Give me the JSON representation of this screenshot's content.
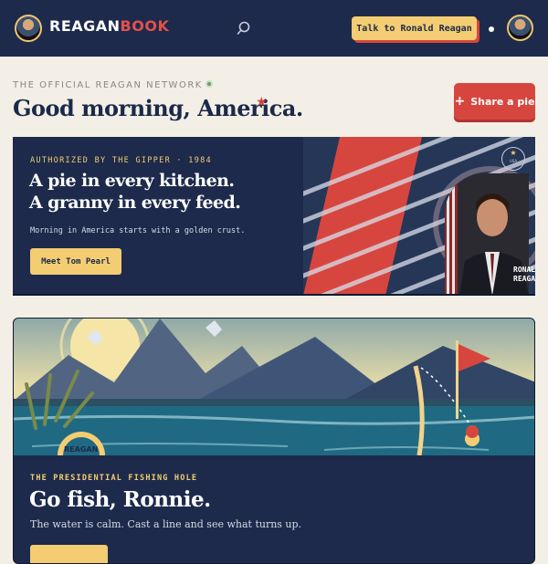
{
  "header": {
    "brand_main": "REAGAN",
    "brand_accent": "BOOK",
    "talk_button": "Talk to Ronald Reagan"
  },
  "greeting": {
    "kicker": "THE OFFICIAL REAGAN NETWORK",
    "headline": "Good morning, America.",
    "share_button": "Share a pie"
  },
  "hero": {
    "kicker": "AUTHORIZED BY THE GIPPER · 1984",
    "title_line1": "A pie in every kitchen.",
    "title_line2": "A granny in every feed.",
    "subtitle": "Morning in America starts with a golden crust.",
    "button": "Meet Tom Pearl",
    "portrait_label_line1": "RONAL",
    "portrait_label_line2": "REAGA",
    "seal_text": "USA"
  },
  "fishing": {
    "buoy_label": "REAGAN",
    "kicker": "THE PRESIDENTIAL FISHING HOLE",
    "title": "Go fish, Ronnie.",
    "subtitle": "The water is calm. Cast a line and see what turns up."
  },
  "colors": {
    "navy": "#1d2a4b",
    "gold": "#f4cd72",
    "red": "#d6463f",
    "cream": "#f4efe6",
    "online_green": "#6aa35f"
  }
}
